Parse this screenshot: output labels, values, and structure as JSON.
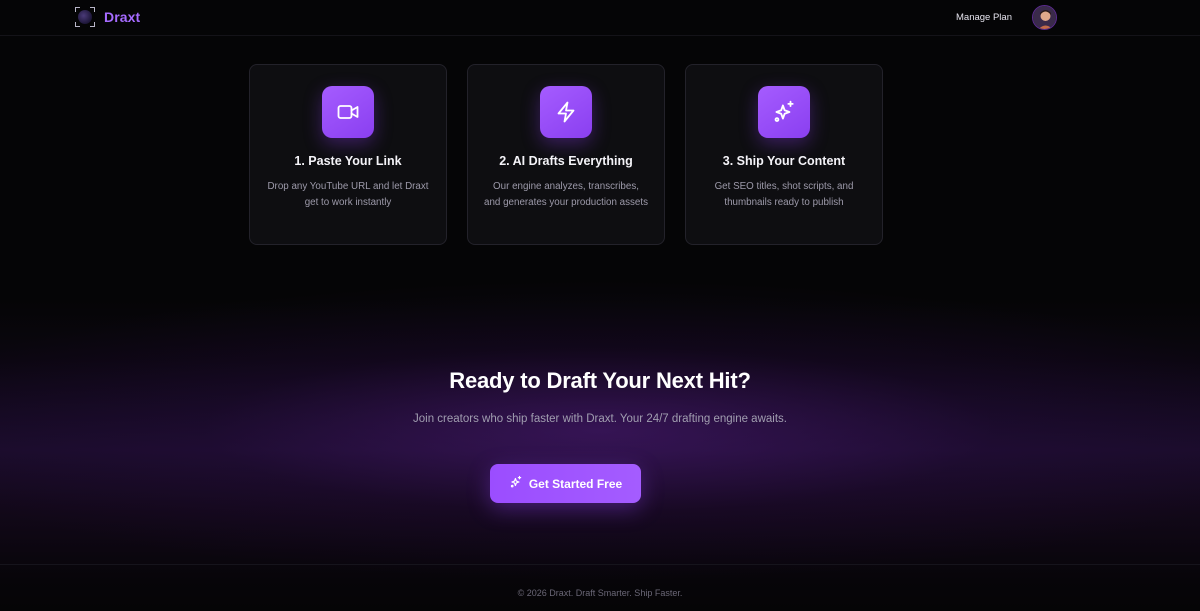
{
  "header": {
    "brand_name": "Draxt",
    "manage_plan_label": "Manage Plan"
  },
  "steps": [
    {
      "icon": "video-icon",
      "title": "1. Paste Your Link",
      "description": "Drop any YouTube URL and let Draxt get to work instantly"
    },
    {
      "icon": "lightning-icon",
      "title": "2. AI Drafts Everything",
      "description": "Our engine analyzes, transcribes, and generates your production assets"
    },
    {
      "icon": "sparkles-icon",
      "title": "3. Ship Your Content",
      "description": "Get SEO titles, shot scripts, and thumbnails ready to publish"
    }
  ],
  "cta": {
    "title": "Ready to Draft Your Next Hit?",
    "subtitle": "Join creators who ship faster with Draxt. Your 24/7 drafting engine awaits.",
    "button_label": "Get Started Free",
    "button_icon": "sparkles-icon"
  },
  "footer": {
    "text": "© 2026 Draxt. Draft Smarter. Ship Faster."
  },
  "colors": {
    "accent": "#a66bff",
    "button": "#9b4dff",
    "background": "#050506",
    "card": "#0e0e11"
  }
}
